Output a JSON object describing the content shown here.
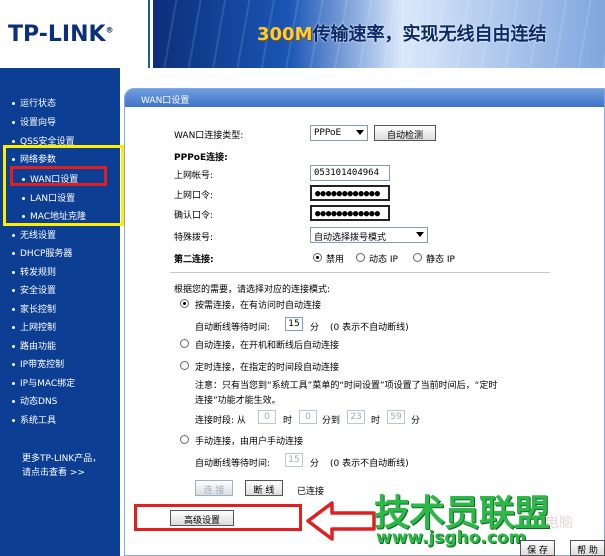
{
  "header": {
    "logo": "TP-LINK",
    "logo_reg": "®",
    "banner_num": "300M",
    "banner_text": "传输速率，实现无线自由连结"
  },
  "sidebar": {
    "items": [
      {
        "label": "运行状态"
      },
      {
        "label": "设置向导"
      },
      {
        "label": "QSS安全设置"
      },
      {
        "label": "网络参数"
      },
      {
        "label": "WAN口设置"
      },
      {
        "label": "LAN口设置"
      },
      {
        "label": "MAC地址克隆"
      },
      {
        "label": "无线设置"
      },
      {
        "label": "DHCP服务器"
      },
      {
        "label": "转发规则"
      },
      {
        "label": "安全设置"
      },
      {
        "label": "家长控制"
      },
      {
        "label": "上网控制"
      },
      {
        "label": "路由功能"
      },
      {
        "label": "IP带宽控制"
      },
      {
        "label": "IP与MAC绑定"
      },
      {
        "label": "动态DNS"
      },
      {
        "label": "系统工具"
      }
    ],
    "more_line1": "更多TP-LINK产品，",
    "more_line2": "请点击查看 >>"
  },
  "panel": {
    "title": "WAN口设置",
    "wan_type_label": "WAN口连接类型:",
    "wan_type_value": "PPPoE",
    "auto_detect_label": "自动检测",
    "pppoe_section": "PPPoE连接:",
    "account_label": "上网帐号:",
    "account_value": "053101404964",
    "password_label": "上网口令:",
    "password_value": "●●●●●●●●●●●●",
    "confirm_label": "确认口令:",
    "confirm_value": "●●●●●●●●●●●●",
    "dial_label": "特殊拨号:",
    "dial_value": "自动选择拨号模式",
    "second_conn_label": "第二连接:",
    "second_conn_options": [
      "禁用",
      "动态 IP",
      "静态 IP"
    ],
    "mode_prompt": "根据您的需要，请选择对应的连接模式:",
    "mode_demand": "按需连接，在有访问时自动连接",
    "idle_label": "自动断线等待时间:",
    "idle_value": "15",
    "idle_unit": "分",
    "idle_hint": "(0 表示不自动断线)",
    "mode_auto": "自动连接，在开机和断线后自动连接",
    "mode_timed": "定时连接，在指定的时间段自动连接",
    "timed_note_1": "注意：只有当您到“系统工具”菜单的“时间设置”项设置了当前时间后，“定时",
    "timed_note_2": "连接”功能才能生效。",
    "period_label": "连接时段: 从",
    "period_from_h": "0",
    "period_h1": "时",
    "period_from_m": "0",
    "period_to": "分到",
    "period_to_h": "23",
    "period_h2": "时",
    "period_to_m": "59",
    "period_m2": "分",
    "mode_manual": "手动连接，由用户手动连接",
    "idle2_label": "自动断线等待时间:",
    "idle2_value": "15",
    "idle2_unit": "分",
    "idle2_hint": "(0 表示不自动断线)",
    "connect_label": "连 接",
    "disconnect_label": "断 线",
    "status_text": "已连接",
    "advanced_label": "高级设置"
  },
  "footer": {
    "save_label": "保 存",
    "help_label": "帮 助"
  },
  "watermark": {
    "text": "技术员联盟",
    "url": "www.jsgho.com",
    "faded": "电脑"
  },
  "colors": {
    "sidebar_bg": "#0c3f94",
    "highlight_yellow": "#ffee00",
    "highlight_red": "#e02020",
    "watermark_green": "#2fb84a"
  }
}
